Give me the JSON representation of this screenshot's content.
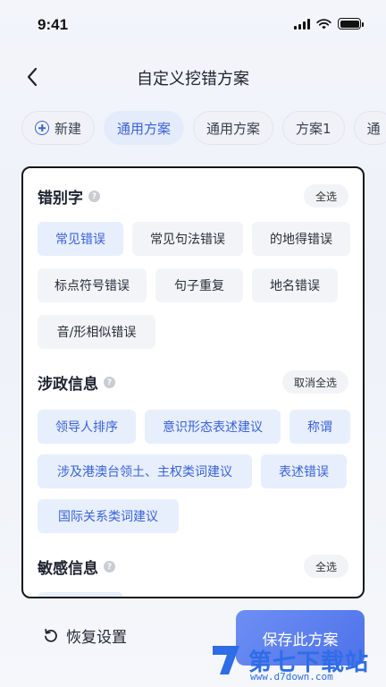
{
  "status_bar": {
    "time": "9:41"
  },
  "nav": {
    "title": "自定义挖错方案"
  },
  "scheme_tabs": [
    {
      "label": "新建",
      "icon": "plus-circle-icon",
      "active": false
    },
    {
      "label": "通用方案",
      "active": true
    },
    {
      "label": "通用方案",
      "active": false
    },
    {
      "label": "方案1",
      "active": false
    },
    {
      "label": "通",
      "active": false
    }
  ],
  "sections": {
    "typo": {
      "title": "错别字",
      "action": "全选",
      "items": [
        "常见错误",
        "常见句法错误",
        "的地得错误",
        "标点符号错误",
        "句子重复",
        "地名错误",
        "音/形相似错误"
      ]
    },
    "political": {
      "title": "涉政信息",
      "action": "取消全选",
      "items": [
        "领导人排序",
        "意识形态表述建议",
        "称谓",
        "涉及港澳台领土、主权类词建议",
        "表述错误",
        "国际关系类词建议"
      ]
    },
    "sensitive": {
      "title": "敏感信息",
      "action": "全选"
    }
  },
  "bottom": {
    "reset_label": "恢复设置",
    "save_label": "保存此方案"
  },
  "watermark": {
    "text": "第七下载站",
    "url": "www.d7down.com"
  },
  "colors": {
    "accent": "#3a63d8",
    "chip_bg": "#f3f4f7",
    "chip_selected_bg": "#e7eefc",
    "save_button": "#5b7ff0"
  }
}
